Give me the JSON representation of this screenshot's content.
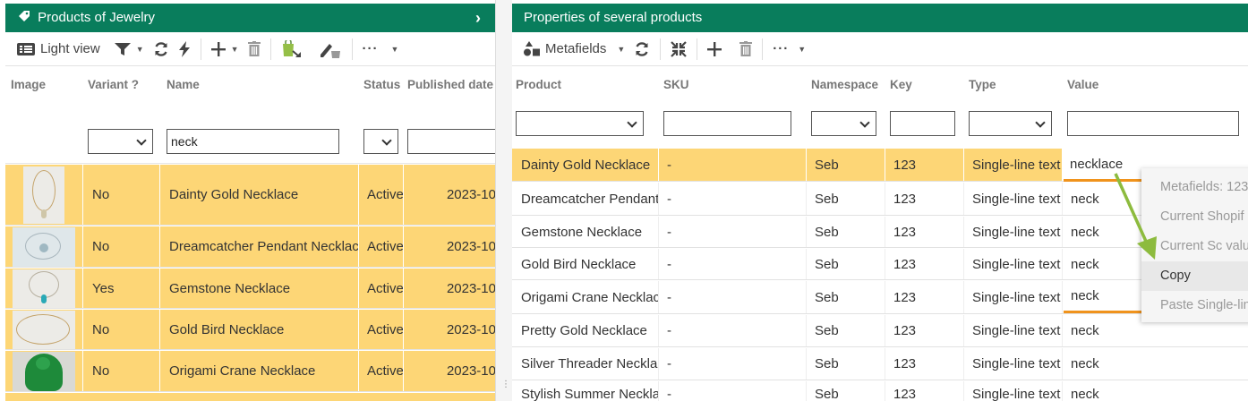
{
  "left": {
    "title": "Products of Jewelry",
    "toolbar": {
      "view_label": "Light view"
    },
    "columns": [
      "Image",
      "Variant ?",
      "Name",
      "Status",
      "Published date"
    ],
    "filters": {
      "name_value": "neck"
    },
    "rows": [
      {
        "variant": "No",
        "name": "Dainty Gold Necklace",
        "status": "Active",
        "date": "2023-10"
      },
      {
        "variant": "No",
        "name": "Dreamcatcher Pendant Necklac",
        "status": "Active",
        "date": "2023-10"
      },
      {
        "variant": "Yes",
        "name": "Gemstone Necklace",
        "status": "Active",
        "date": "2023-10"
      },
      {
        "variant": "No",
        "name": "Gold Bird Necklace",
        "status": "Active",
        "date": "2023-10"
      },
      {
        "variant": "No",
        "name": "Origami Crane Necklace",
        "status": "Active",
        "date": "2023-10"
      }
    ]
  },
  "right": {
    "title": "Properties of several products",
    "toolbar": {
      "metafields_label": "Metafields"
    },
    "columns": [
      "Product",
      "SKU",
      "Namespace",
      "Key",
      "Type",
      "Value"
    ],
    "rows": [
      {
        "product": "Dainty Gold Necklace",
        "sku": "-",
        "namespace": "Seb",
        "key": "123",
        "type": "Single-line text",
        "value": "necklace"
      },
      {
        "product": "Dreamcatcher Pendant",
        "sku": "-",
        "namespace": "Seb",
        "key": "123",
        "type": "Single-line text",
        "value": "neck"
      },
      {
        "product": "Gemstone Necklace",
        "sku": "-",
        "namespace": "Seb",
        "key": "123",
        "type": "Single-line text",
        "value": "neck"
      },
      {
        "product": "Gold Bird Necklace",
        "sku": "-",
        "namespace": "Seb",
        "key": "123",
        "type": "Single-line text",
        "value": "neck"
      },
      {
        "product": "Origami Crane Necklac",
        "sku": "-",
        "namespace": "Seb",
        "key": "123",
        "type": "Single-line text",
        "value": "neck"
      },
      {
        "product": "Pretty Gold Necklace",
        "sku": "-",
        "namespace": "Seb",
        "key": "123",
        "type": "Single-line text",
        "value": "neck"
      },
      {
        "product": "Silver Threader Neckla",
        "sku": "-",
        "namespace": "Seb",
        "key": "123",
        "type": "Single-line text",
        "value": "neck"
      },
      {
        "product": "Stylish Summer Neckla",
        "sku": "-",
        "namespace": "Seb",
        "key": "123",
        "type": "Single-line text",
        "value": "neck"
      }
    ]
  },
  "context_menu": {
    "items": [
      "Metafields: 123",
      "Current Shopif",
      "Current Sc valu",
      "Copy",
      "Paste Single-lin"
    ]
  },
  "colors": {
    "header_green": "#097d5c",
    "highlight_row": "#fdd676",
    "underline_orange": "#f0931c",
    "arrow_green": "#8dbb3e"
  }
}
